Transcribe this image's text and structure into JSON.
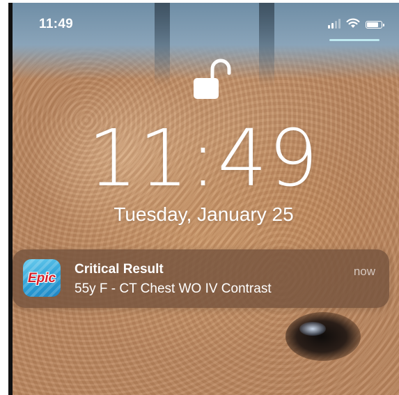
{
  "status_bar": {
    "time": "11:49",
    "signal_bars": 4,
    "signal_bars_active": 2,
    "battery_level": 0.85,
    "icons": [
      "signal-icon",
      "wifi-icon",
      "battery-icon"
    ]
  },
  "lock_screen": {
    "lock_icon": "unlocked-padlock-icon",
    "clock": "11:49",
    "date": "Tuesday, January 25"
  },
  "notification": {
    "app_icon": "epic-app-icon",
    "app_logo_text": "Epic",
    "title": "Critical Result",
    "body": "55y F - CT Chest WO IV Contrast",
    "time": "now"
  },
  "colors": {
    "notification_bg": "#76543e",
    "epic_blue": "#2a9fd6",
    "epic_red": "#d4202a",
    "swipe_indicator": "#bfe9f0"
  }
}
